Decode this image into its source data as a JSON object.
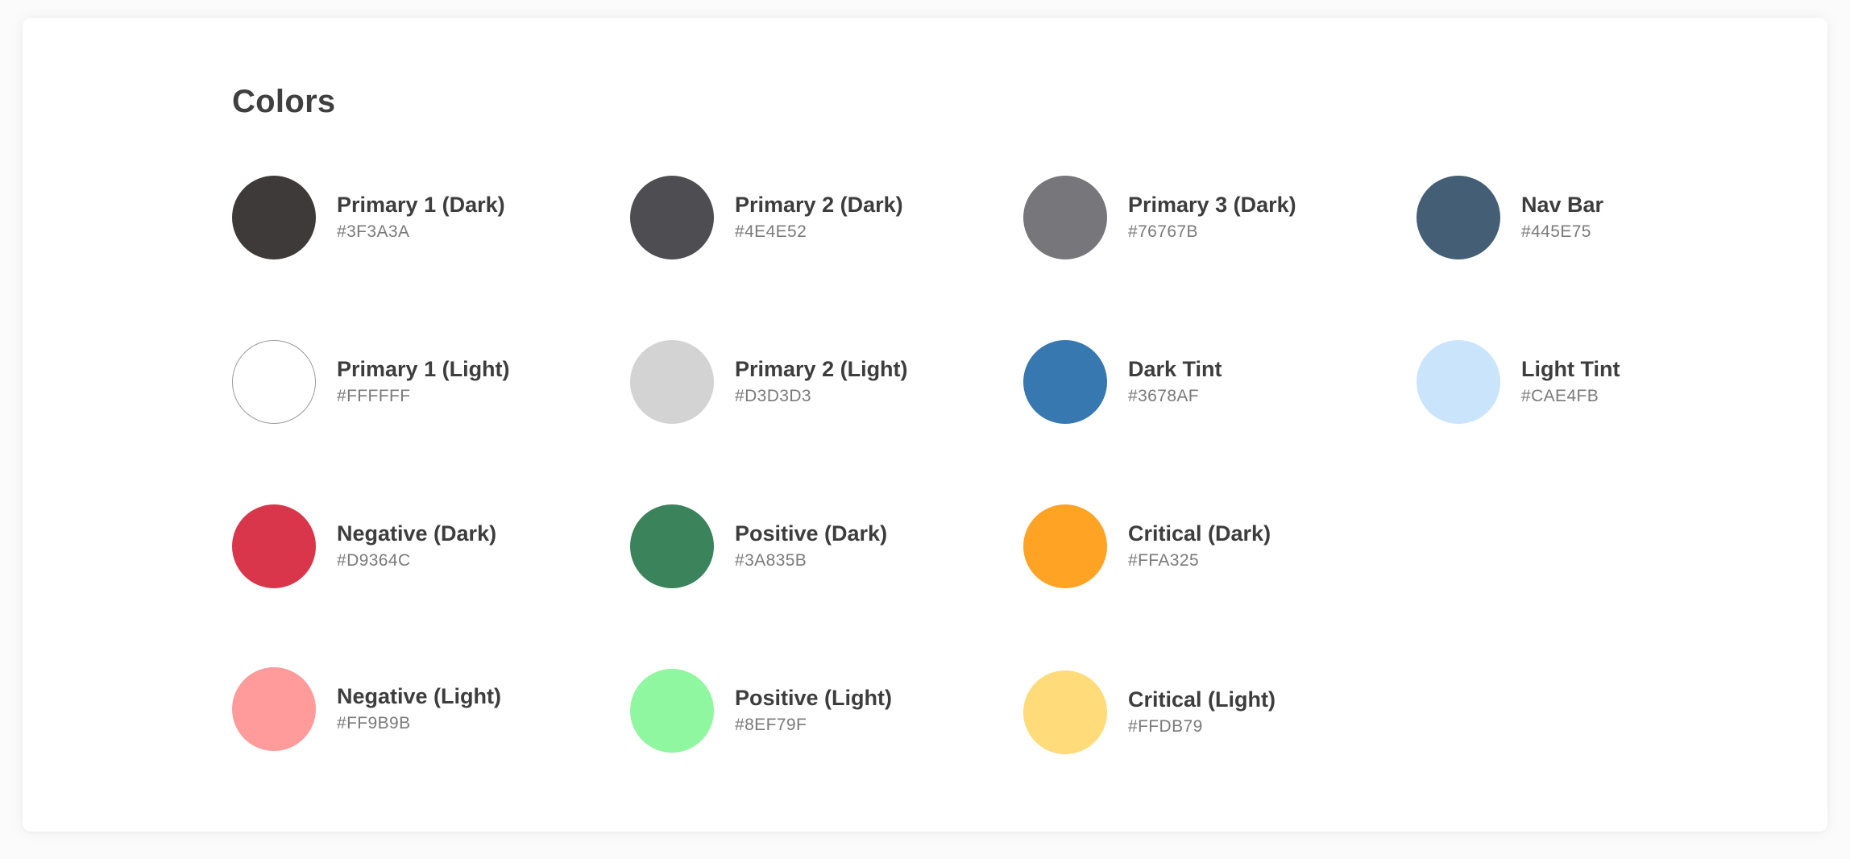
{
  "page": {
    "title": "Colors"
  },
  "swatches": [
    {
      "name": "Primary 1 (Dark)",
      "hex": "#3F3A3A",
      "color": "#3F3A3A"
    },
    {
      "name": "Primary 2 (Dark)",
      "hex": "#4E4E52",
      "color": "#4E4E52"
    },
    {
      "name": "Primary 3 (Dark)",
      "hex": "#76767B",
      "color": "#76767B"
    },
    {
      "name": "Nav Bar",
      "hex": "#445E75",
      "color": "#445E75"
    },
    {
      "name": "Primary 1 (Light)",
      "hex": "#FFFFFF",
      "color": "#FFFFFF"
    },
    {
      "name": "Primary 2 (Light)",
      "hex": "#D3D3D3",
      "color": "#D3D3D3"
    },
    {
      "name": "Dark Tint",
      "hex": "#3678AF",
      "color": "#3678AF"
    },
    {
      "name": "Light Tint",
      "hex": "#CAE4FB",
      "color": "#CAE4FB"
    },
    {
      "name": "Negative (Dark)",
      "hex": "#D9364C",
      "color": "#D9364C"
    },
    {
      "name": "Positive (Dark)",
      "hex": "#3A835B",
      "color": "#3A835B"
    },
    {
      "name": "Critical (Dark)",
      "hex": "#FFA325",
      "color": "#FFA325"
    },
    {
      "name": "Negative (Light)",
      "hex": "#FF9B9B",
      "color": "#FF9B9B"
    },
    {
      "name": "Positive (Light)",
      "hex": "#8EF79F",
      "color": "#8EF79F"
    },
    {
      "name": "Critical (Light)",
      "hex": "#FFDB79",
      "color": "#FFDB79"
    }
  ]
}
